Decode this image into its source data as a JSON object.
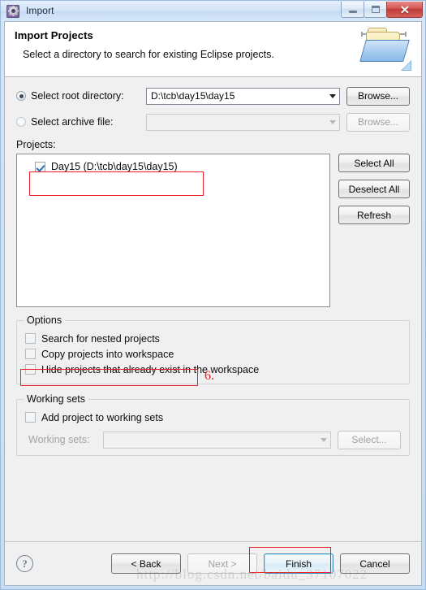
{
  "window": {
    "title": "Import",
    "icon": "eclipse-import-gear-icon",
    "caption_buttons": {
      "minimize": "–",
      "maximize": "□",
      "close": "✕"
    }
  },
  "banner": {
    "title": "Import Projects",
    "subtitle": "Select a directory to search for existing Eclipse projects.",
    "icon": "open-folder-icon"
  },
  "source": {
    "root_directory": {
      "label": "Select root directory:",
      "selected": true,
      "value": "D:\\tcb\\day15\\day15",
      "browse_label": "Browse...",
      "enabled": true
    },
    "archive_file": {
      "label": "Select archive file:",
      "selected": false,
      "value": "",
      "browse_label": "Browse...",
      "enabled": false
    }
  },
  "projects": {
    "label": "Projects:",
    "items": [
      {
        "name": "Day15 (D:\\tcb\\day15\\day15)",
        "checked": true
      }
    ],
    "buttons": {
      "select_all": "Select All",
      "deselect_all": "Deselect All",
      "refresh": "Refresh"
    }
  },
  "options": {
    "title": "Options",
    "items": [
      {
        "label": "Search for nested projects",
        "checked": false
      },
      {
        "label": "Copy projects into workspace",
        "checked": false
      },
      {
        "label": "Hide projects that already exist in the workspace",
        "checked": false
      }
    ]
  },
  "working_sets": {
    "title": "Working sets",
    "add_label": "Add project to working sets",
    "add_checked": false,
    "sets_label": "Working sets:",
    "sets_value": "",
    "select_label": "Select...",
    "enabled": false
  },
  "footer": {
    "help": "?",
    "back": "< Back",
    "next": "Next >",
    "finish": "Finish",
    "cancel": "Cancel"
  },
  "annotations": {
    "step_number": "6."
  },
  "watermark": {
    "text": "http://blog.csdn.net/baidu_37107022"
  },
  "colors": {
    "annotation_red": "#ee1c25",
    "default_button_border": "#3c93c2",
    "checkbox_check": "#2f6fb5"
  }
}
